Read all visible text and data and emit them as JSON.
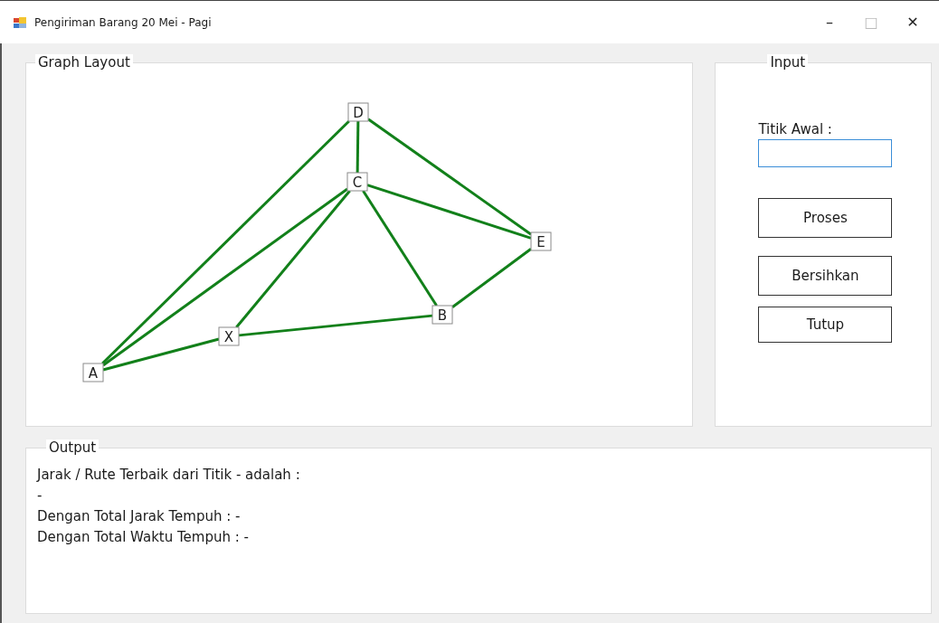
{
  "window": {
    "title": "Pengiriman Barang 20 Mei - Pagi",
    "controls": [
      "–",
      "□",
      "✕"
    ]
  },
  "graph": {
    "title": "Graph Layout",
    "nodes": [
      "D",
      "C",
      "E",
      "B",
      "X",
      "A"
    ]
  },
  "input": {
    "title": "Input",
    "field_label": "Titik Awal :",
    "buttons": [
      "Proses",
      "Bersihkan",
      "Tutup"
    ]
  },
  "output": {
    "title": "Output",
    "lines": [
      "Jarak / Rute Terbaik dari Titik - adalah :",
      "-",
      "Dengan Total Jarak Tempuh : -",
      "Dengan Total Waktu Tempuh : -"
    ]
  }
}
